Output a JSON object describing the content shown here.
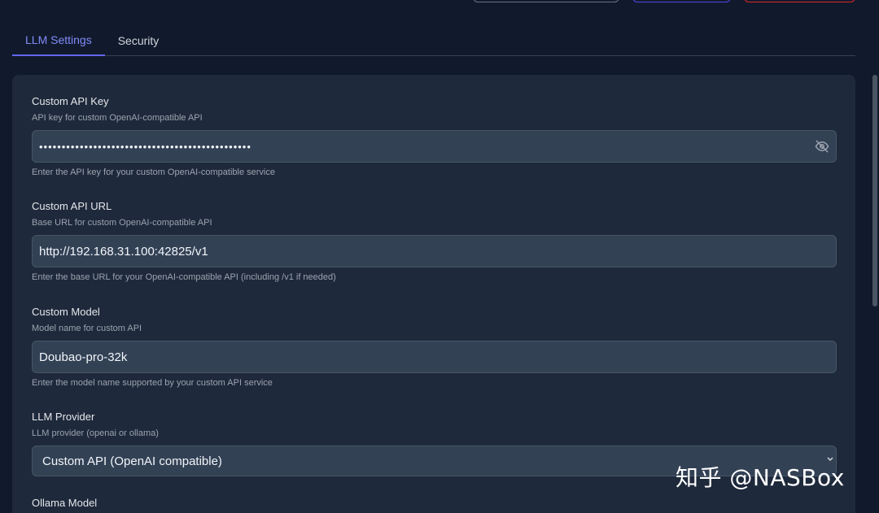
{
  "tabs": [
    {
      "label": "LLM Settings",
      "active": true
    },
    {
      "label": "Security",
      "active": false
    }
  ],
  "fields": {
    "api_key": {
      "label": "Custom API Key",
      "description": "API key for custom OpenAI-compatible API",
      "value": "•••••••••••••••••••••••••••••••••••••••••••••••",
      "hint": "Enter the API key for your custom OpenAI-compatible service",
      "icon": "eye-off-icon"
    },
    "api_url": {
      "label": "Custom API URL",
      "description": "Base URL for custom OpenAI-compatible API",
      "value": "http://192.168.31.100:42825/v1",
      "hint": "Enter the base URL for your OpenAI-compatible API (including /v1 if needed)"
    },
    "model": {
      "label": "Custom Model",
      "description": "Model name for custom API",
      "value": "Doubao-pro-32k",
      "hint": "Enter the model name supported by your custom API service"
    },
    "provider": {
      "label": "LLM Provider",
      "description": "LLM provider (openai or ollama)",
      "selected": "Custom API (OpenAI compatible)"
    },
    "ollama_model": {
      "label": "Ollama Model"
    }
  },
  "watermark": "知乎 @NASBox",
  "colors": {
    "accent": "#818cf8",
    "background": "#111a2c",
    "card": "#1e293b",
    "input": "#334155"
  }
}
